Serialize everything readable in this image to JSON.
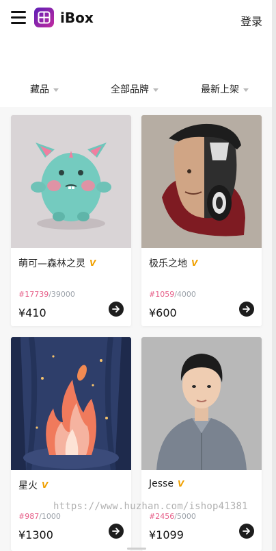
{
  "header": {
    "brand": "iBox",
    "login_label": "登录"
  },
  "filters": [
    {
      "label": "藏品"
    },
    {
      "label": "全部品牌"
    },
    {
      "label": "最新上架"
    }
  ],
  "cards": [
    {
      "name": "萌可—森林之灵",
      "badge": "V",
      "edition_current": "#17739",
      "edition_total": "/39000",
      "price": "¥410"
    },
    {
      "name": "极乐之地",
      "badge": "V",
      "edition_current": "#1059",
      "edition_total": "/4000",
      "price": "¥600"
    },
    {
      "name": "星火",
      "badge": "V",
      "edition_current": "#987",
      "edition_total": "/1000",
      "price": "¥1300"
    },
    {
      "name": "Jesse",
      "badge": "V",
      "edition_current": "#2456",
      "edition_total": "/5000",
      "price": "¥1099"
    }
  ],
  "watermark": "https://www.huzhan.com/ishop41381",
  "colors": {
    "edition_current": "#e65b86",
    "badge": "#f0a000",
    "logo_gradient_start": "#5c1eb6",
    "logo_gradient_end": "#c22b9f"
  }
}
